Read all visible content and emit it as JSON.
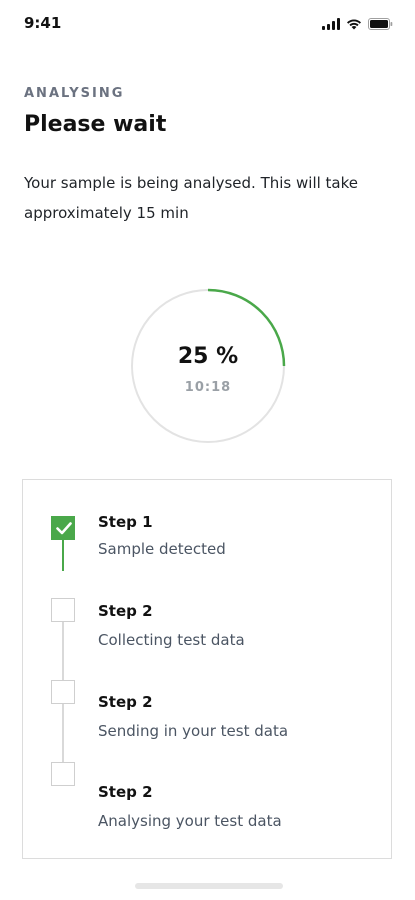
{
  "status_bar": {
    "time": "9:41",
    "icons": [
      "signal-icon",
      "wifi-icon",
      "battery-icon"
    ]
  },
  "header": {
    "eyebrow": "ANALYSING",
    "title": "Please wait",
    "description": "Your sample is being analysed. This will take approximately 15 min"
  },
  "progress": {
    "percent_label": "25 %",
    "value": 0.25,
    "time_label": "10:18",
    "track_color": "#e3e3e3",
    "fill_color": "#4aa84a"
  },
  "steps": [
    {
      "title": "Step 1",
      "subtitle": "Sample detected",
      "done": true
    },
    {
      "title": "Step 2",
      "subtitle": "Collecting test data",
      "done": false
    },
    {
      "title": "Step 2",
      "subtitle": "Sending in your test data",
      "done": false
    },
    {
      "title": "Step 2",
      "subtitle": "Analysing your test data",
      "done": false
    }
  ],
  "colors": {
    "accent": "#4aa84a",
    "muted_text": "#6b7280"
  }
}
